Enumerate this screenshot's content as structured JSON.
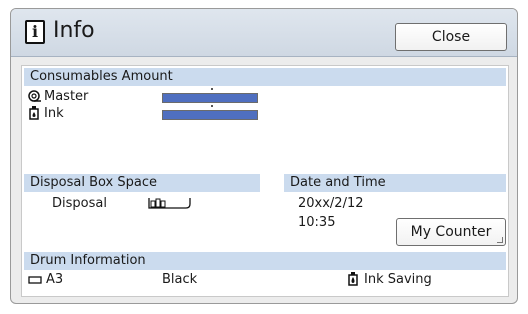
{
  "header": {
    "title": "Info",
    "close_label": "Close"
  },
  "consumables": {
    "heading": "Consumables Amount",
    "master": {
      "label": "Master",
      "level": 1.0,
      "icon": "master-roll-icon"
    },
    "ink": {
      "label": "Ink",
      "level": 1.0,
      "icon": "ink-cartridge-icon"
    }
  },
  "disposal": {
    "heading": "Disposal Box Space",
    "label": "Disposal",
    "icon": "disposal-box-icon"
  },
  "datetime": {
    "heading": "Date and Time",
    "date": "20xx/2/12",
    "time": "10:35",
    "counter_label": "My Counter"
  },
  "drum": {
    "heading": "Drum Information",
    "size": "A3",
    "color": "Black",
    "ink_saving": "Ink Saving",
    "size_icon": "paper-size-icon",
    "ink_saving_icon": "ink-saving-icon"
  },
  "colors": {
    "accent_bar": "#cbdbee",
    "level_fill": "#4f6fc0"
  }
}
